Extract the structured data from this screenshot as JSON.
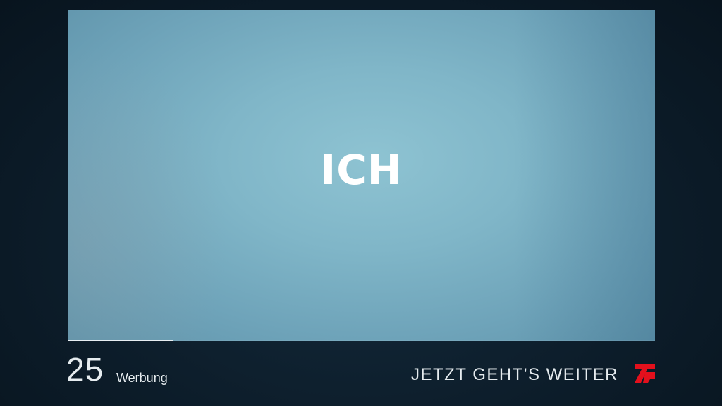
{
  "video": {
    "overlay_text": "ICH"
  },
  "progress": {
    "value": 0.18
  },
  "ad_break": {
    "countdown": "25",
    "label": "Werbung",
    "continue_text": "JETZT GEHT'S WEITER"
  },
  "channel": {
    "logo_icon": "prosieben-logo",
    "logo_color": "#e3101c"
  },
  "colors": {
    "background": "#0d1e2c",
    "video_background": "#80b6c8",
    "text": "#e6ecef"
  }
}
